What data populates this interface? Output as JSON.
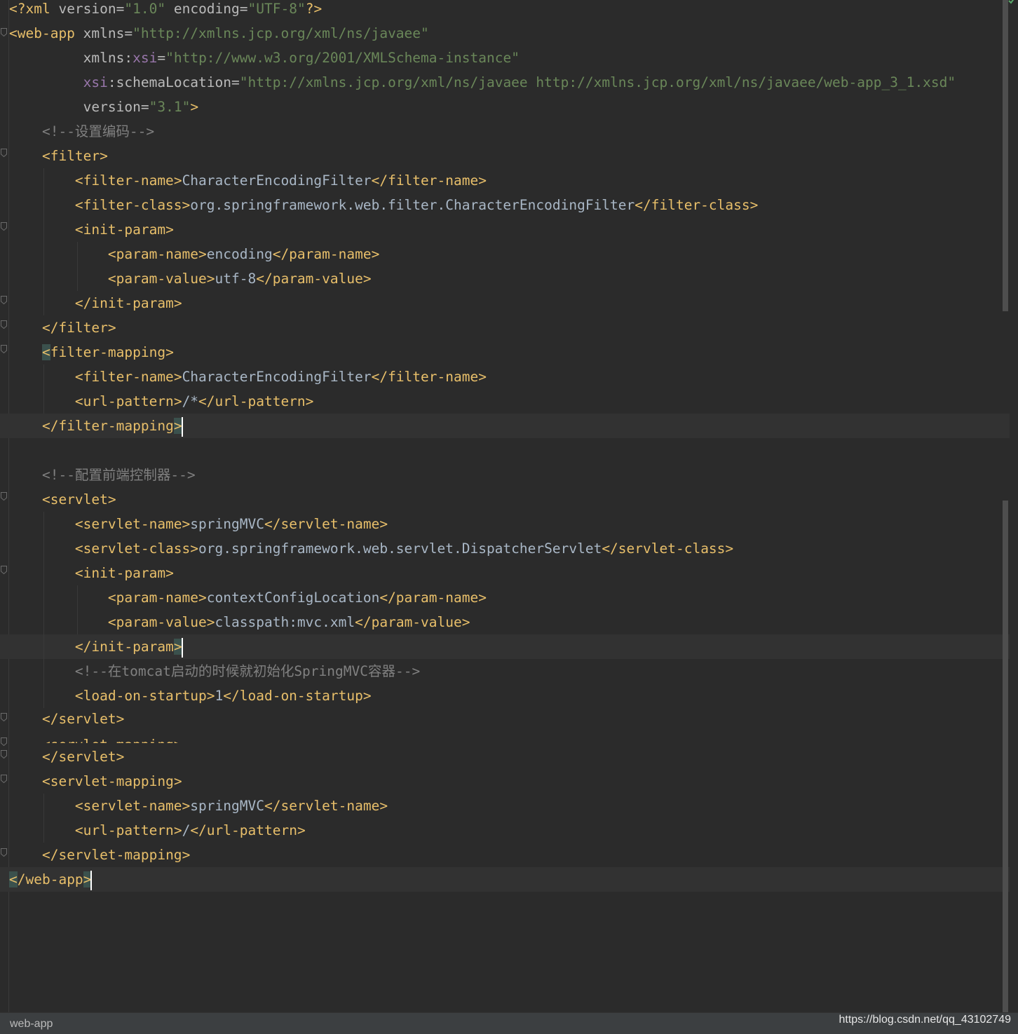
{
  "colors": {
    "background": "#2b2b2b",
    "tag": "#e8bf6a",
    "attribute": "#bababa",
    "value": "#6a8759",
    "namespace": "#9876aa",
    "comment": "#808080",
    "text": "#a9b7c6"
  },
  "lines": [
    {
      "text": "<?xml version=\"1.0\" encoding=\"UTF-8\"?>"
    },
    {
      "text": "<web-app xmlns=\"http://xmlns.jcp.org/xml/ns/javaee\""
    },
    {
      "text": "         xmlns:xsi=\"http://www.w3.org/2001/XMLSchema-instance\""
    },
    {
      "text": "         xsi:schemaLocation=\"http://xmlns.jcp.org/xml/ns/javaee http://xmlns.jcp.org/xml/ns/javaee/web-app_3_1.xsd\""
    },
    {
      "text": "         version=\"3.1\">"
    },
    {
      "text": "    <!--设置编码-->"
    },
    {
      "text": "    <filter>"
    },
    {
      "text": "        <filter-name>CharacterEncodingFilter</filter-name>"
    },
    {
      "text": "        <filter-class>org.springframework.web.filter.CharacterEncodingFilter</filter-class>"
    },
    {
      "text": "        <init-param>"
    },
    {
      "text": "            <param-name>encoding</param-name>"
    },
    {
      "text": "            <param-value>utf-8</param-value>"
    },
    {
      "text": "        </init-param>"
    },
    {
      "text": "    </filter>"
    },
    {
      "text": "    <filter-mapping>"
    },
    {
      "text": "        <filter-name>CharacterEncodingFilter</filter-name>"
    },
    {
      "text": "        <url-pattern>/*</url-pattern>"
    },
    {
      "text": "    </filter-mapping>"
    },
    {
      "text": ""
    },
    {
      "text": "    <!--配置前端控制器-->"
    },
    {
      "text": "    <servlet>"
    },
    {
      "text": "        <servlet-name>springMVC</servlet-name>"
    },
    {
      "text": "        <servlet-class>org.springframework.web.servlet.DispatcherServlet</servlet-class>"
    },
    {
      "text": "        <init-param>"
    },
    {
      "text": "            <param-name>contextConfigLocation</param-name>"
    },
    {
      "text": "            <param-value>classpath:mvc.xml</param-value>"
    },
    {
      "text": "        </init-param>"
    },
    {
      "text": "        <!--在tomcat启动的时候就初始化SpringMVC容器-->"
    },
    {
      "text": "        <load-on-startup>1</load-on-startup>"
    },
    {
      "text": "    </servlet>"
    },
    {
      "text": "    <servlet-mapping>"
    },
    {
      "text": "    </servlet>"
    },
    {
      "text": "    <servlet-mapping>"
    },
    {
      "text": "        <servlet-name>springMVC</servlet-name>"
    },
    {
      "text": "        <url-pattern>/</url-pattern>"
    },
    {
      "text": "    </servlet-mapping>"
    },
    {
      "text": "</web-app>"
    }
  ],
  "statusbar": {
    "breadcrumb": "web-app"
  },
  "watermark": "https://blog.csdn.net/qq_43102749"
}
